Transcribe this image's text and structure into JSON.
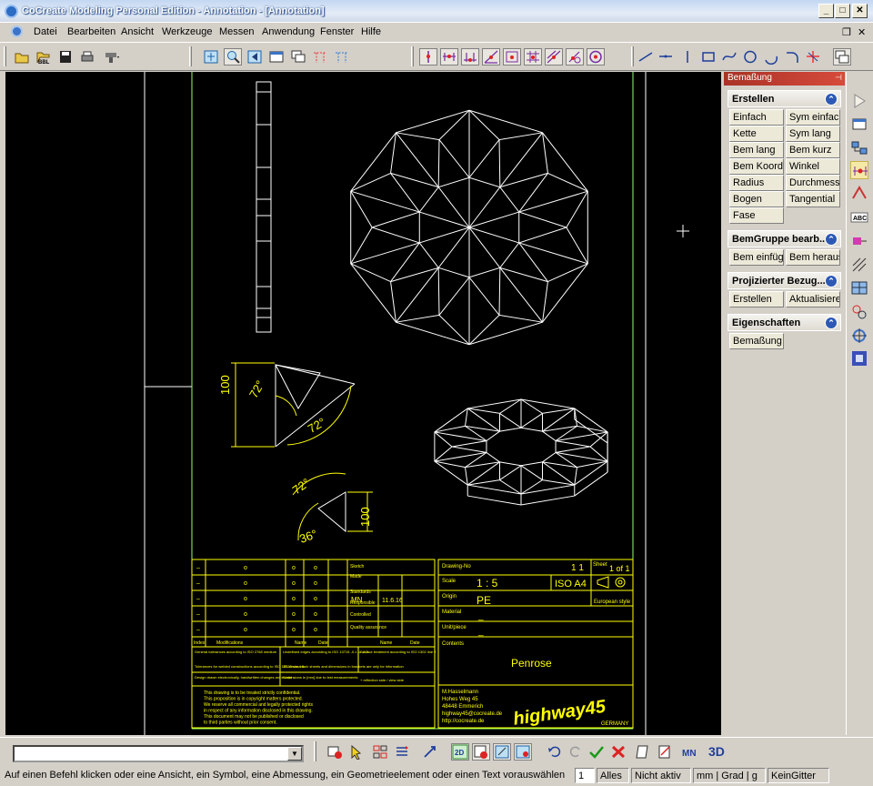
{
  "window": {
    "title": "CoCreate Modeling Personal Edition - Annotation - [Annotation]",
    "minimize": "_",
    "maximize": "□",
    "close": "✕",
    "mdi_restore": "❐",
    "mdi_close": "✕"
  },
  "menu": [
    "Datei",
    "Bearbeiten",
    "Ansicht",
    "Werkzeuge",
    "Messen",
    "Anwendung",
    "Fenster",
    "Hilfe"
  ],
  "panel": {
    "title": "Bemaßung",
    "pin": "⊣",
    "sections": [
      {
        "title": "Erstellen",
        "collapse": "⌃",
        "buttons": [
          "Einfach",
          "Sym einfach",
          "Kette",
          "Sym lang",
          "Bem lang",
          "Bem kurz",
          "Bem Koord",
          "Winkel",
          "Radius",
          "Durchmesser",
          "Bogen",
          "Tangential",
          "Fase"
        ]
      },
      {
        "title": "BemGruppe bearb...",
        "collapse": "⌃",
        "buttons": [
          "Bem einfügen",
          "Bem heraus"
        ]
      },
      {
        "title": "Projizierter Bezug...",
        "collapse": "⌃",
        "buttons": [
          "Erstellen",
          "Aktualisieren"
        ]
      },
      {
        "title": "Eigenschaften",
        "collapse": "⌃",
        "buttons": [
          "Bemaßung"
        ]
      }
    ]
  },
  "drawing": {
    "dim_100_top": "100",
    "dim_72_a": "72°",
    "dim_72_b": "72°",
    "dim_72_c": "72°",
    "dim_36": "36°",
    "dim_100_bottom": "100",
    "title_block": {
      "drawing_no_label": "Drawing-No",
      "sheet_label": "Sheet",
      "drawing_no": "1 1",
      "sheet_no": "1 of 1",
      "scale_label": "Scale",
      "scale": "1   :   5",
      "format": "ISO A4",
      "projection": "European style",
      "origin_label": "Origin",
      "origin": "PE",
      "material_label": "Material",
      "material": "_",
      "unit_label": "Unit/piece",
      "unit": "_",
      "content_label": "Contents",
      "content": "Penrose",
      "address": [
        "M.Hasselmann",
        "Hohes Weg 45",
        "48448 Emmerich",
        "highway45@cocreate.de",
        "http://cocreate.de"
      ],
      "brand": "highway45",
      "country": "GERMANY",
      "rev_row_cells": [
        "–",
        "o",
        "o",
        "o"
      ],
      "check_labels": [
        "Sketch",
        "Made",
        "Standards",
        "Responsible",
        "Controlled",
        "Quality assurance"
      ],
      "resp_values": [
        "MN",
        "11.6.16"
      ],
      "rev_headers": [
        "Index",
        "Modifications",
        "Name",
        "Date",
        "Name",
        "Date"
      ],
      "notes": [
        "General tolerances according to ISO 2768 medium",
        "Undefined edges according to ISO 13715 -0.1 to -0.3",
        "Surface treatment according to ISO 1302 line 2",
        "Tolerances for welded constructions according to ISO 13920 class A",
        "3D-views, blank sheets and dimensions in brackets are only for information",
        "Design drawn electronically, handwritten changes are invalid",
        "Dimensions in [mm] due to test measurements",
        "+ reflection side / view side"
      ],
      "confidential": [
        "This drawing is to be treated strictly confidential.",
        "This proposition is in copyright matters protected.",
        "We reserve all commercial and legally protected rights",
        "in respect of any information disclosed in this drawing.",
        "This document may not be published or disclosed",
        "to third parties without prior consent."
      ]
    }
  },
  "bottombar": {
    "icon_3d": "3D"
  },
  "status": {
    "message": "Auf einen Befehl klicken oder eine Ansicht, ein Symbol, eine Abmessung, ein Geometrieelement oder einen Text vorauswählen",
    "count": "1",
    "filter": "Alles",
    "active": "Nicht aktiv",
    "units": "mm | Grad | g",
    "grid": "KeinGitter"
  },
  "colors": {
    "drawing_line": "#ffffff",
    "dimension": "#ffff00",
    "frame": "#99ff66",
    "title_block": "#ffff00",
    "panel_header": "#c0392b"
  }
}
